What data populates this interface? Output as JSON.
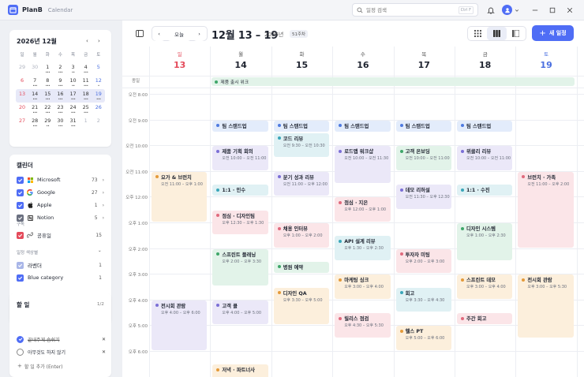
{
  "app": {
    "name": "PlanB",
    "section": "Calendar"
  },
  "search": {
    "placeholder": "일정 검색",
    "shortcut": "Ctrl F"
  },
  "mini": {
    "title": "2026년 12월",
    "weekdays": [
      "일",
      "월",
      "화",
      "수",
      "목",
      "금",
      "토"
    ],
    "weeks": [
      [
        {
          "d": "29",
          "o": 1
        },
        {
          "d": "30",
          "o": 1
        },
        {
          "d": "1",
          "dots": "•••"
        },
        {
          "d": "2",
          "dots": "•••"
        },
        {
          "d": "3",
          "dots": "••"
        },
        {
          "d": "4",
          "dots": "•••"
        },
        {
          "d": "5"
        }
      ],
      [
        {
          "d": "6"
        },
        {
          "d": "7",
          "dots": "•••"
        },
        {
          "d": "8",
          "dots": "•••"
        },
        {
          "d": "9",
          "dots": "•••"
        },
        {
          "d": "10",
          "dots": "••"
        },
        {
          "d": "11",
          "dots": "•••"
        },
        {
          "d": "12",
          "dots": "•"
        }
      ],
      [
        {
          "d": "13"
        },
        {
          "d": "14",
          "dots": "•••"
        },
        {
          "d": "15",
          "dots": "•••"
        },
        {
          "d": "16",
          "dots": "•••"
        },
        {
          "d": "17",
          "dots": "•••"
        },
        {
          "d": "18",
          "dots": "•••"
        },
        {
          "d": "19",
          "dots": "•••"
        }
      ],
      [
        {
          "d": "20"
        },
        {
          "d": "21",
          "dots": "•••"
        },
        {
          "d": "22",
          "dots": "•••"
        },
        {
          "d": "23",
          "dots": "•••"
        },
        {
          "d": "24",
          "dots": "•••"
        },
        {
          "d": "25",
          "dots": "•••"
        },
        {
          "d": "26"
        }
      ],
      [
        {
          "d": "27"
        },
        {
          "d": "28",
          "dots": "•••"
        },
        {
          "d": "29",
          "dots": "••"
        },
        {
          "d": "30",
          "dots": "•••"
        },
        {
          "d": "31",
          "dots": "•••"
        },
        {
          "d": "1",
          "o": 1
        },
        {
          "d": "2",
          "o": 1
        }
      ]
    ]
  },
  "calendars": {
    "title": "캘린더",
    "items": [
      {
        "label": "Microsoft",
        "count": "73",
        "color": "#4f6df5",
        "icon": "microsoft-icon"
      },
      {
        "label": "Google",
        "count": "27",
        "color": "#4f6df5",
        "icon": "google-icon"
      },
      {
        "label": "Apple",
        "count": "1",
        "color": "#4f6df5",
        "icon": "apple-icon"
      },
      {
        "label": "Notion",
        "count": "5",
        "color": "#6b7080",
        "icon": "notion-icon"
      }
    ],
    "subscribed_label": "구독",
    "subscribed": {
      "label": "공휴일",
      "count": "15",
      "color": "#e44b5b",
      "icon": "link-icon"
    },
    "colors_label": "일정 색상별",
    "color_items": [
      {
        "label": "라벤더",
        "count": "1",
        "color": "#a9b6e8"
      },
      {
        "label": "Blue category",
        "count": "1",
        "color": "#4f6df5"
      }
    ]
  },
  "todo": {
    "title": "할 일",
    "count": "1/2",
    "items": [
      {
        "label": "끝내주게 숨쉬기",
        "done": true
      },
      {
        "label": "아무것도 하지 않기",
        "done": false
      }
    ],
    "add_label": "할 일 추가 (Enter)"
  },
  "toolbar": {
    "today": "오늘",
    "range": "12월 13 – 19",
    "year": "2026년",
    "week": "51주차",
    "new_event": "새 일정"
  },
  "days": [
    {
      "name": "일",
      "num": "13",
      "color": "#e44b5b"
    },
    {
      "name": "월",
      "num": "14",
      "color": "#1f2430"
    },
    {
      "name": "화",
      "num": "15",
      "color": "#1f2430"
    },
    {
      "name": "수",
      "num": "16",
      "color": "#1f2430"
    },
    {
      "name": "목",
      "num": "17",
      "color": "#1f2430"
    },
    {
      "name": "금",
      "num": "18",
      "color": "#1f2430"
    },
    {
      "name": "토",
      "num": "19",
      "color": "#4a6fe0"
    }
  ],
  "allday_label": "종일",
  "allday_event": {
    "title": "제품 출시 위크",
    "day": 1,
    "span": 6
  },
  "hours": [
    "오전 8:00",
    "오전 9:00",
    "오전 10:00",
    "오전 11:00",
    "오후 12:00",
    "오후 1:00",
    "오후 2:00",
    "오후 3:00",
    "오후 4:00",
    "오후 5:00",
    "오후 6:00"
  ],
  "events": [
    {
      "day": 0,
      "start": 11,
      "end": 13,
      "title": "요가 & 브런치",
      "time": "오전 11:00 – 오후 1:00",
      "theme": "orange"
    },
    {
      "day": 0,
      "start": 16,
      "end": 18,
      "title": "전시회 관람",
      "time": "오후 4:00 – 오후 6:00",
      "theme": "purple"
    },
    {
      "day": 1,
      "start": 9,
      "end": 9.5,
      "title": "팀 스탠드업",
      "time": "",
      "theme": "blue"
    },
    {
      "day": 1,
      "start": 10,
      "end": 11,
      "title": "제품 기획 회의",
      "time": "오전 10:00 – 오전 11:00",
      "theme": "purple"
    },
    {
      "day": 1,
      "start": 11.5,
      "end": 12,
      "title": "1:1 · 민수",
      "time": "",
      "theme": "cyan"
    },
    {
      "day": 1,
      "start": 12.5,
      "end": 13.5,
      "title": "점심 · 디자인팀",
      "time": "오후 12:30 – 오후 1:30",
      "theme": "pink"
    },
    {
      "day": 1,
      "start": 14,
      "end": 15.5,
      "title": "스프린트 플래닝",
      "time": "오후 2:00 – 오후 3:30",
      "theme": "green"
    },
    {
      "day": 1,
      "start": 16,
      "end": 17,
      "title": "고객 콜",
      "time": "오후 4:00 – 오후 5:00",
      "theme": "purple"
    },
    {
      "day": 1,
      "start": 18.5,
      "end": 19.5,
      "title": "저녁 · 파트너사",
      "time": "",
      "theme": "orange"
    },
    {
      "day": 2,
      "start": 9,
      "end": 9.5,
      "title": "팀 스탠드업",
      "time": "",
      "theme": "blue"
    },
    {
      "day": 2,
      "start": 9.5,
      "end": 10.5,
      "title": "코드 리뷰",
      "time": "오전 9:30 – 오전 10:30",
      "theme": "cyan"
    },
    {
      "day": 2,
      "start": 11,
      "end": 12,
      "title": "분기 성과 리뷰",
      "time": "오전 11:00 – 오후 12:00",
      "theme": "purple"
    },
    {
      "day": 2,
      "start": 13,
      "end": 14,
      "title": "채용 인터뷰",
      "time": "오후 1:00 – 오후 2:00",
      "theme": "pink"
    },
    {
      "day": 2,
      "start": 14.5,
      "end": 15,
      "title": "병원 예약",
      "time": "",
      "theme": "green"
    },
    {
      "day": 2,
      "start": 15.5,
      "end": 17,
      "title": "디자인 QA",
      "time": "오후 3:30 – 오후 5:00",
      "theme": "orange"
    },
    {
      "day": 3,
      "start": 9,
      "end": 9.5,
      "title": "팀 스탠드업",
      "time": "",
      "theme": "blue"
    },
    {
      "day": 3,
      "start": 10,
      "end": 11.5,
      "title": "로드맵 워크샵",
      "time": "오전 10:00 – 오전 11:30",
      "theme": "purple"
    },
    {
      "day": 3,
      "start": 12,
      "end": 13,
      "title": "점심 · 지은",
      "time": "오후 12:00 – 오후 1:00",
      "theme": "pink"
    },
    {
      "day": 3,
      "start": 13.5,
      "end": 14.5,
      "title": "API 설계 리뷰",
      "time": "오후 1:30 – 오후 2:30",
      "theme": "cyan"
    },
    {
      "day": 3,
      "start": 15,
      "end": 16,
      "title": "마케팅 싱크",
      "time": "오후 3:00 – 오후 4:00",
      "theme": "orange"
    },
    {
      "day": 3,
      "start": 16.5,
      "end": 17.5,
      "title": "릴리스 점검",
      "time": "오후 4:30 – 오후 5:30",
      "theme": "pink"
    },
    {
      "day": 4,
      "start": 9,
      "end": 9.5,
      "title": "팀 스탠드업",
      "time": "",
      "theme": "blue"
    },
    {
      "day": 4,
      "start": 10,
      "end": 11,
      "title": "고객 온보딩",
      "time": "오전 10:00 – 오전 11:00",
      "theme": "green"
    },
    {
      "day": 4,
      "start": 11.5,
      "end": 12.5,
      "title": "데모 리허설",
      "time": "오전 11:30 – 오후 12:30",
      "theme": "purple"
    },
    {
      "day": 4,
      "start": 14,
      "end": 15,
      "title": "투자자 미팅",
      "time": "오후 2:00 – 오후 3:00",
      "theme": "pink"
    },
    {
      "day": 4,
      "start": 15.5,
      "end": 16.5,
      "title": "회고",
      "time": "오후 3:30 – 오후 4:30",
      "theme": "cyan"
    },
    {
      "day": 4,
      "start": 17,
      "end": 18,
      "title": "헬스 PT",
      "time": "오후 5:00 – 오후 6:00",
      "theme": "orange"
    },
    {
      "day": 5,
      "start": 9,
      "end": 9.5,
      "title": "팀 스탠드업",
      "time": "",
      "theme": "blue"
    },
    {
      "day": 5,
      "start": 10,
      "end": 11,
      "title": "위클리 리뷰",
      "time": "오전 10:00 – 오전 11:00",
      "theme": "purple"
    },
    {
      "day": 5,
      "start": 11.5,
      "end": 12,
      "title": "1:1 · 수진",
      "time": "",
      "theme": "cyan"
    },
    {
      "day": 5,
      "start": 13,
      "end": 14.5,
      "title": "디자인 시스템",
      "time": "오후 1:00 – 오후 2:30",
      "theme": "green"
    },
    {
      "day": 5,
      "start": 15,
      "end": 16,
      "title": "스프린트 데모",
      "time": "오후 3:00 – 오후 4:00",
      "theme": "orange"
    },
    {
      "day": 5,
      "start": 16.5,
      "end": 17,
      "title": "주간 회고",
      "time": "",
      "theme": "pink"
    },
    {
      "day": 6,
      "start": 11,
      "end": 14,
      "title": "브런치 · 가족",
      "time": "오전 11:00 – 오후 2:00",
      "theme": "pink"
    },
    {
      "day": 6,
      "start": 15,
      "end": 17.5,
      "title": "전시회 관람",
      "time": "오후 3:00 – 오후 5:30",
      "theme": "orange"
    }
  ],
  "themes": {
    "blue": {
      "bg": "#e3ecfb",
      "dot": "#4f7be0"
    },
    "purple": {
      "bg": "#ebe8f8",
      "dot": "#7b6fd6"
    },
    "cyan": {
      "bg": "#e0f1f4",
      "dot": "#3aa6b9"
    },
    "pink": {
      "bg": "#fbe5e8",
      "dot": "#e06a7d"
    },
    "green": {
      "bg": "#e2f3e9",
      "dot": "#3fa76a"
    },
    "orange": {
      "bg": "#fcefdc",
      "dot": "#e49a3a"
    }
  }
}
